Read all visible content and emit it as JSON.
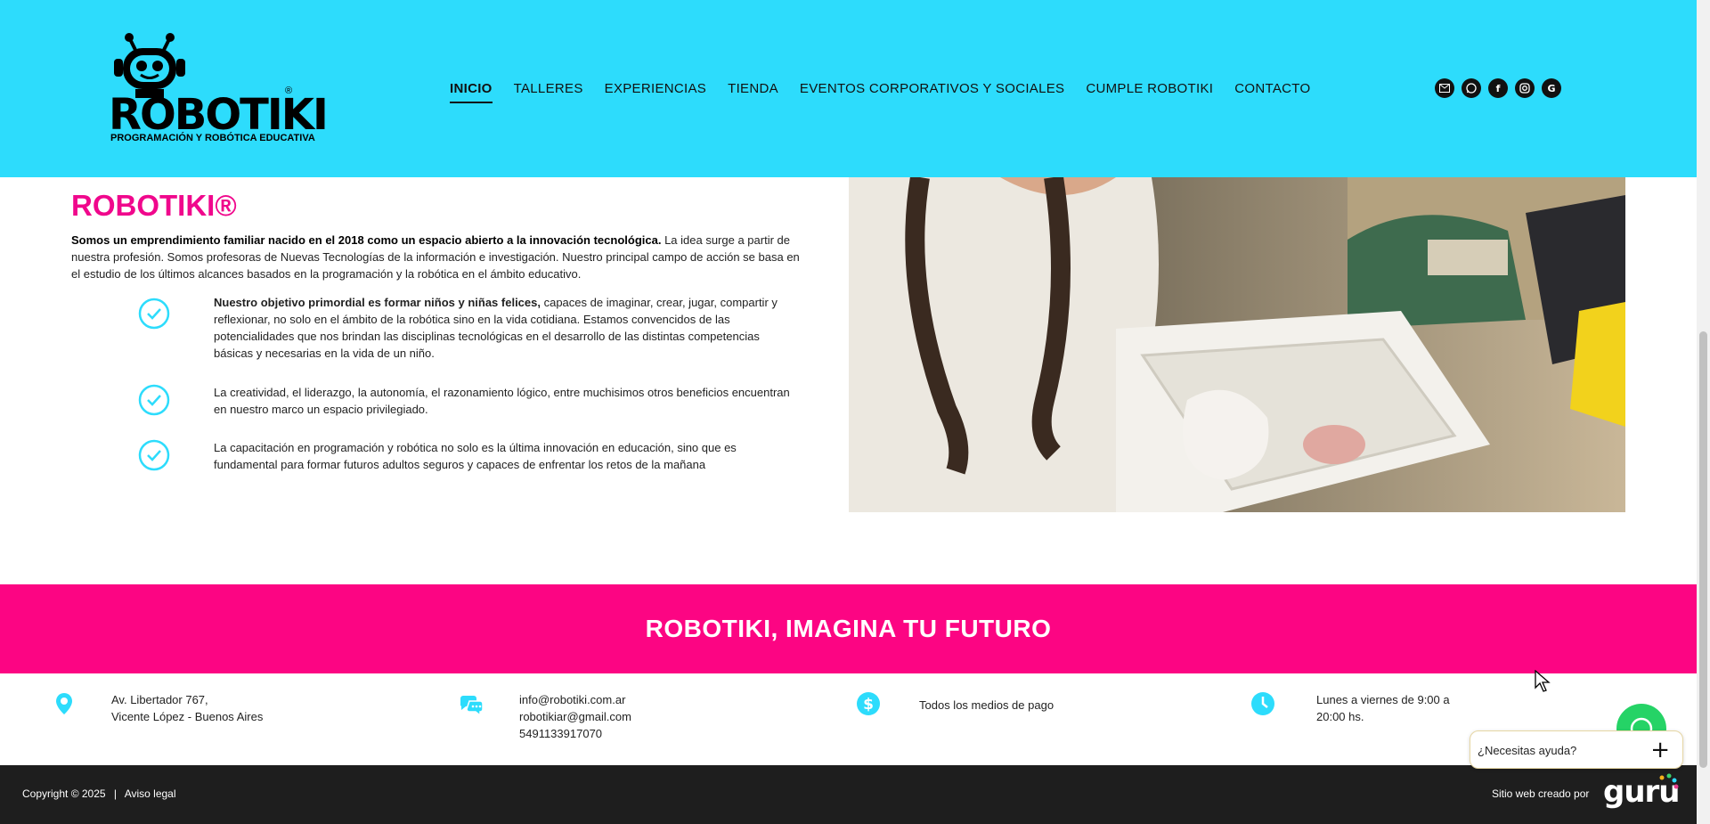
{
  "header": {
    "logo": {
      "wordmark": "ROBOTIKI",
      "registered": "®",
      "tagline": "PROGRAMACIÓN Y ROBÓTICA EDUCATIVA"
    },
    "nav": [
      {
        "label": "INICIO",
        "active": true
      },
      {
        "label": "TALLERES"
      },
      {
        "label": "EXPERIENCIAS"
      },
      {
        "label": "TIENDA"
      },
      {
        "label": "EVENTOS CORPORATIVOS Y SOCIALES"
      },
      {
        "label": "CUMPLE ROBOTIKI"
      },
      {
        "label": "CONTACTO"
      }
    ],
    "social_icons": [
      "email-icon",
      "whatsapp-icon",
      "facebook-icon",
      "instagram-icon",
      "google-icon"
    ],
    "bg_color": "#2ddcfc"
  },
  "intro": {
    "title": "ROBOTIKI®",
    "lead_bold": "Somos un emprendimiento familiar nacido en el 2018 como un espacio abierto a la innovación tecnológica.",
    "lead_rest": " La idea surge a partir de nuestra profesión. Somos profesoras de Nuevas Tecnologías de la información e investigación. Nuestro principal campo de acción se basa en el estudio de los últimos alcances basados en la programación y la robótica en el ámbito educativo.",
    "title_color": "#f0078c"
  },
  "checklist": [
    {
      "bold": "Nuestro objetivo primordial es formar niños y niñas felices,",
      "text": " capaces de imaginar, crear, jugar, compartir y reflexionar, no solo en el ámbito de la robótica sino en la vida cotidiana. Estamos convencidos de las potencialidades que nos brindan las disciplinas tecnológicas en el desarrollo de las distintas competencias básicas y necesarias en la vida de un niño."
    },
    {
      "bold": "",
      "text": "La creatividad, el liderazgo, la autonomía, el razonamiento lógico, entre muchisimos otros beneficios encuentran en nuestro marco un espacio privilegiado."
    },
    {
      "bold": "",
      "text": "La capacitación en programación y robótica no solo es la última innovación en educación, sino que es fundamental para formar futuros adultos seguros y capaces de enfrentar los retos de la mañana"
    }
  ],
  "banner": {
    "title": "ROBOTIKI, IMAGINA TU FUTURO",
    "bg_color": "#fc0583"
  },
  "contact": {
    "address_line1": "Av. Libertador 767,",
    "address_line2": "Vicente López - Buenos Aires",
    "email1": "info@robotiki.com.ar",
    "email2": "robotikiar@gmail.com",
    "phone": "5491133917070",
    "payment": "Todos los medios de pago",
    "hours_line1": "Lunes a viernes de 9:00 a",
    "hours_line2": "20:00 hs.",
    "icon_color": "#2ddcfc"
  },
  "footer": {
    "copyright": "Copyright © 2025",
    "separator": "|",
    "legal": "Aviso legal",
    "credit": "Sitio web creado por",
    "brand": "guru"
  },
  "whatsapp_widget": {
    "label": "¿Necesitas ayuda?",
    "plus": "+"
  }
}
